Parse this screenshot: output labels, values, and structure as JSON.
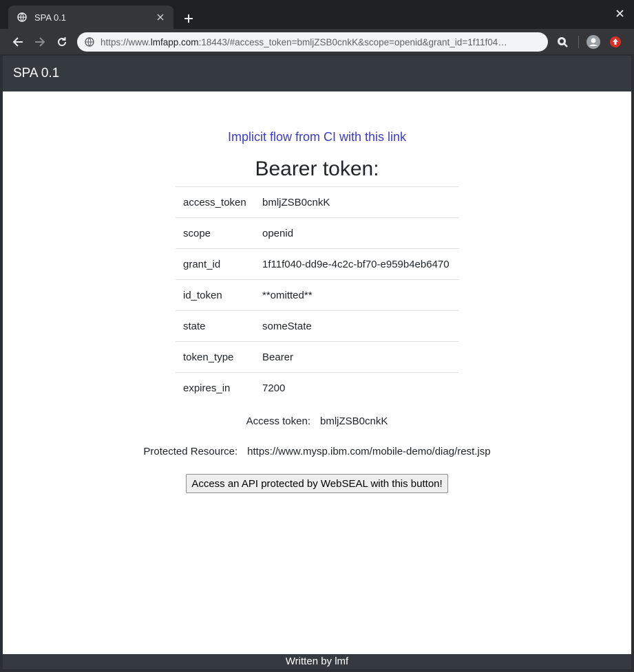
{
  "browser": {
    "tab_title": "SPA 0.1",
    "url_prefix": "https://www.",
    "url_host": "lmfapp.com",
    "url_rest": ":18443/#access_token=bmljZSB0cnkK&scope=openid&grant_id=1f11f04…",
    "icons": [
      "globe-icon",
      "close-icon",
      "plus-icon",
      "back-arrow-icon",
      "forward-arrow-icon",
      "reload-icon",
      "search-extension-icon",
      "profile-avatar-icon",
      "update-badge-icon"
    ]
  },
  "navbar": {
    "brand": "SPA 0.1"
  },
  "main": {
    "implicit_link": "Implicit flow from CI with this link",
    "heading": "Bearer token:",
    "token_rows": [
      {
        "key": "access_token",
        "value": "bmljZSB0cnkK"
      },
      {
        "key": "scope",
        "value": "openid"
      },
      {
        "key": "grant_id",
        "value": "1f11f040-dd9e-4c2c-bf70-e959b4eb6470"
      },
      {
        "key": "id_token",
        "value": "**omitted**"
      },
      {
        "key": "state",
        "value": "someState"
      },
      {
        "key": "token_type",
        "value": "Bearer"
      },
      {
        "key": "expires_in",
        "value": "7200"
      }
    ],
    "access_token_label": "Access token:",
    "access_token_value": "bmljZSB0cnkK",
    "protected_resource_label": "Protected Resource:",
    "protected_resource_value": "https://www.mysp.ibm.com/mobile-demo/diag/rest.jsp",
    "api_button_label": "Access an API protected by WebSEAL with this button!"
  },
  "footer": {
    "text": "Written by lmf"
  },
  "colors": {
    "navbar": "#343a40",
    "link": "#3a3acf",
    "chrome_dark": "#202124",
    "chrome_tab": "#35363a"
  }
}
